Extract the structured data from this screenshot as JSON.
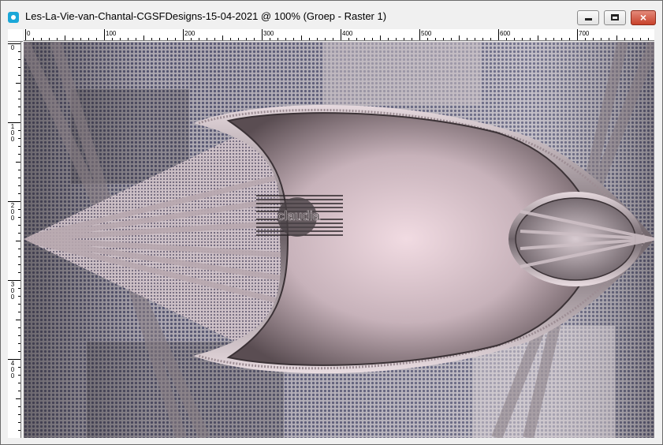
{
  "window": {
    "title": "Les-La-Vie-van-Chantal-CGSFDesigns-15-04-2021 @ 100% (Groep - Raster 1)",
    "app_icon": "camera-icon",
    "buttons": {
      "minimize_icon": "minimize-icon",
      "maximize_icon": "maximize-icon",
      "close_icon": "close-icon",
      "close_glyph": "×"
    }
  },
  "ruler": {
    "top_labels": [
      "0",
      "100",
      "200",
      "300",
      "400",
      "500",
      "600",
      "700"
    ],
    "left_labels": [
      "0",
      "100",
      "200",
      "300",
      "400"
    ]
  },
  "canvas": {
    "watermark_text": "claudia",
    "colors": {
      "accent_pink": "#e8cfd8",
      "mauve": "#8a7a80",
      "dark": "#3b3236",
      "blue_gray": "#7d7f9c"
    }
  }
}
